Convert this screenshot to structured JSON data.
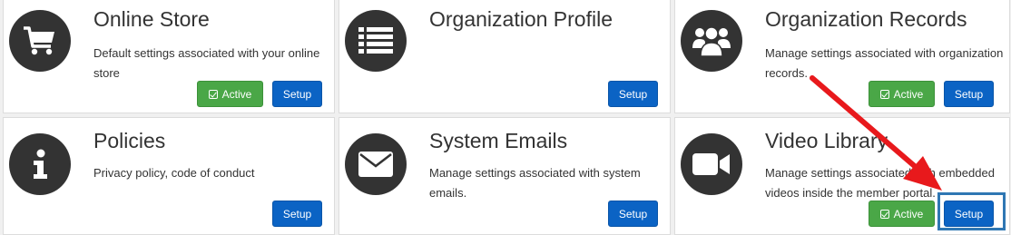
{
  "cards": [
    {
      "title": "Online Store",
      "desc": "Default settings associated with your online store",
      "icon": "cart-icon",
      "active": true
    },
    {
      "title": "Organization Profile",
      "desc": "",
      "icon": "list-icon",
      "active": false
    },
    {
      "title": "Organization Records",
      "desc": "Manage settings associated with organization records.",
      "icon": "users-icon",
      "active": true
    },
    {
      "title": "Policies",
      "desc": "Privacy policy, code of conduct",
      "icon": "info-icon",
      "active": false
    },
    {
      "title": "System Emails",
      "desc": "Manage settings associated with system emails.",
      "icon": "envelope-icon",
      "active": false
    },
    {
      "title": "Video Library",
      "desc": "Manage settings associated with embedded videos inside the member portal.",
      "icon": "video-camera-icon",
      "active": true
    }
  ],
  "labels": {
    "setup": "Setup",
    "active": "Active"
  },
  "colors": {
    "setup_button": "#0b63c4",
    "active_button": "#4aa747",
    "icon_circle": "#333333",
    "annotation_arrow": "#e8191c",
    "annotation_box": "#2f77b3"
  }
}
